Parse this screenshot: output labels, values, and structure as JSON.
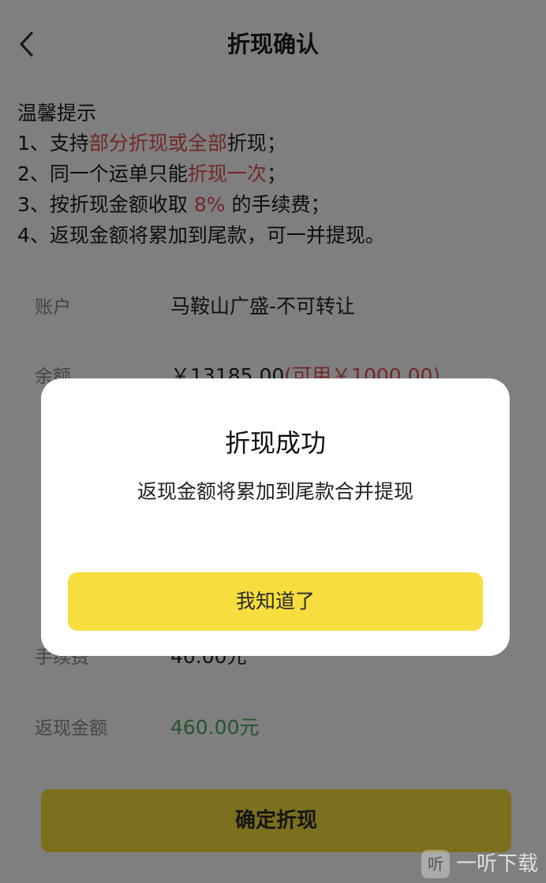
{
  "header": {
    "title": "折现确认"
  },
  "tips": {
    "heading": "温馨提示",
    "items": [
      {
        "prefix": "1、支持",
        "highlight": "部分折现或全部",
        "suffix": "折现；"
      },
      {
        "prefix": "2、同一个运单只能",
        "highlight": "折现一次",
        "suffix": "；"
      },
      {
        "prefix": "3、按折现金额收取 ",
        "highlight": "8%",
        "suffix": " 的手续费；"
      },
      {
        "prefix": "4、返现金额将累加到尾款，可一并提现。",
        "highlight": "",
        "suffix": ""
      }
    ]
  },
  "account": {
    "account_label": "账户",
    "account_value": "马鞍山广盛-不可转让",
    "balance_label": "余额",
    "balance_value": "￥13185.00",
    "balance_available": "(可用￥1000.00)",
    "fee_label": "手续费",
    "fee_value": "40.00元",
    "cashback_label": "返现金额",
    "cashback_value": "460.00元"
  },
  "confirm_button": "确定折现",
  "dialog": {
    "title": "折现成功",
    "message": "返现金额将累加到尾款合并提现",
    "button": "我知道了"
  },
  "watermark": {
    "badge": "听",
    "text": "一听下载"
  },
  "colors": {
    "accent_yellow": "#f8de3c",
    "highlight_red": "#e35050",
    "cashback_green": "#4caa5c",
    "overlay": "rgba(0,0,0,0.5)"
  }
}
